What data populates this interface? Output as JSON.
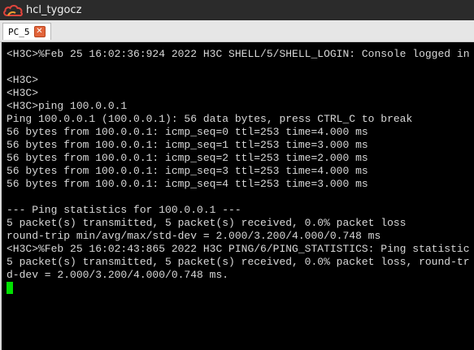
{
  "window": {
    "title": "hcl_tygocz",
    "accent_color": "#2b2b2b"
  },
  "tabs": [
    {
      "label": "PC_5",
      "close_icon": "close-icon"
    }
  ],
  "terminal": {
    "text_color": "#d8d8d8",
    "cursor_color": "#00e000",
    "lines": [
      "<H3C>%Feb 25 16:02:36:924 2022 H3C SHELL/5/SHELL_LOGIN: Console logged in",
      "",
      "<H3C>",
      "<H3C>",
      "<H3C>ping 100.0.0.1",
      "Ping 100.0.0.1 (100.0.0.1): 56 data bytes, press CTRL_C to break",
      "56 bytes from 100.0.0.1: icmp_seq=0 ttl=253 time=4.000 ms",
      "56 bytes from 100.0.0.1: icmp_seq=1 ttl=253 time=3.000 ms",
      "56 bytes from 100.0.0.1: icmp_seq=2 ttl=253 time=2.000 ms",
      "56 bytes from 100.0.0.1: icmp_seq=3 ttl=253 time=4.000 ms",
      "56 bytes from 100.0.0.1: icmp_seq=4 ttl=253 time=3.000 ms",
      "",
      "--- Ping statistics for 100.0.0.1 ---",
      "5 packet(s) transmitted, 5 packet(s) received, 0.0% packet loss",
      "round-trip min/avg/max/std-dev = 2.000/3.200/4.000/0.748 ms",
      "<H3C>%Feb 25 16:02:43:865 2022 H3C PING/6/PING_STATISTICS: Ping statistic",
      "5 packet(s) transmitted, 5 packet(s) received, 0.0% packet loss, round-tr",
      "d-dev = 2.000/3.200/4.000/0.748 ms."
    ]
  }
}
